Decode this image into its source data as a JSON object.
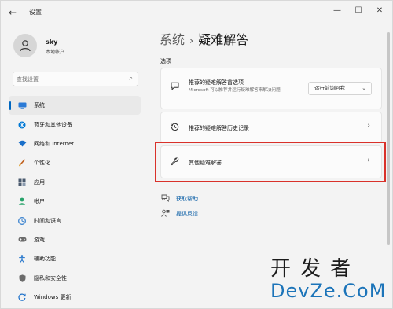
{
  "window": {
    "title": "设置",
    "controls": {
      "minimize": "—",
      "maximize": "☐",
      "close": "✕"
    }
  },
  "profile": {
    "name": "sky",
    "account": "本地帐户"
  },
  "search": {
    "placeholder": "查找设置"
  },
  "sidebar": {
    "items": [
      {
        "label": "系统",
        "icon": "monitor-icon",
        "selected": true
      },
      {
        "label": "蓝牙和其他设备",
        "icon": "bluetooth-icon"
      },
      {
        "label": "网络和 Internet",
        "icon": "wifi-icon"
      },
      {
        "label": "个性化",
        "icon": "brush-icon"
      },
      {
        "label": "应用",
        "icon": "apps-icon"
      },
      {
        "label": "帐户",
        "icon": "person-icon"
      },
      {
        "label": "时间和语言",
        "icon": "globe-clock-icon"
      },
      {
        "label": "游戏",
        "icon": "gamepad-icon"
      },
      {
        "label": "辅助功能",
        "icon": "accessibility-icon"
      },
      {
        "label": "隐私和安全性",
        "icon": "shield-icon"
      },
      {
        "label": "Windows 更新",
        "icon": "update-icon"
      }
    ]
  },
  "main": {
    "breadcrumb_parent": "系统",
    "breadcrumb_sep": "›",
    "breadcrumb_current": "疑难解答",
    "section_label": "选项",
    "cards": [
      {
        "title": "推荐的疑难解答首选项",
        "description": "Microsoft 可以推荐并运行疑难解答来解决问题",
        "dropdown_value": "运行前询问我"
      },
      {
        "title": "推荐的疑难解答历史记录"
      },
      {
        "title": "其他疑难解答"
      }
    ],
    "links": [
      {
        "label": "获取帮助"
      },
      {
        "label": "提供反馈"
      }
    ]
  },
  "watermark": {
    "cn": "开发者",
    "en": "DevZe.CoM"
  },
  "colors": {
    "accent": "#0067c0",
    "highlight": "#d9312a",
    "link": "#0058a3",
    "watermark_en": "#1c74b9"
  }
}
